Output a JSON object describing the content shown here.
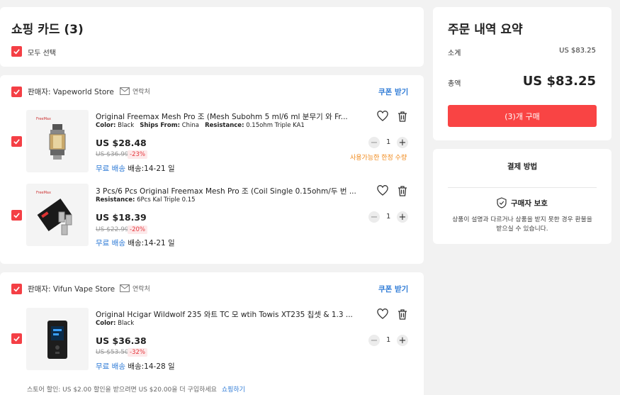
{
  "cart": {
    "title": "쇼핑 카드 (3)",
    "select_all_label": "모두 선택"
  },
  "stores": [
    {
      "seller_label": "판매자: Vapeworld Store",
      "contact_label": "연락처",
      "coupon_label": "쿠폰 받기",
      "items": [
        {
          "name": "Original Freemax Mesh Pro 조 (Mesh Subohm 5 ml/6 ml 분무기 와 Fr...",
          "attrs": [
            {
              "key": "Color:",
              "value": "Black"
            },
            {
              "key": "Ships From:",
              "value": "China"
            },
            {
              "key": "Resistance:",
              "value": "0.15ohm Triple KA1"
            }
          ],
          "price": "US $28.48",
          "original_price": "US $36.99",
          "discount": "-23%",
          "free_shipping": "무료 배송",
          "delivery": "배송:14-21 일",
          "quantity": "1",
          "limit_note": "사용가능한 한정 수량"
        },
        {
          "name": "3 Pcs/6 Pcs Original Freemax Mesh Pro 조 (Coil Single 0.15ohm/두 번 ...",
          "attrs": [
            {
              "key": "Resistance:",
              "value": "6Pcs Kal Triple 0.15"
            }
          ],
          "price": "US $18.39",
          "original_price": "US $22.99",
          "discount": "-20%",
          "free_shipping": "무료 배송",
          "delivery": "배송:14-21 일",
          "quantity": "1"
        }
      ]
    },
    {
      "seller_label": "판매자: Vifun Vape Store",
      "contact_label": "연락처",
      "coupon_label": "쿠폰 받기",
      "items": [
        {
          "name": "Original Hcigar Wildwolf 235 와트 TC 모 wtih Towis XT235 칩셋 & 1.3 ...",
          "attrs": [
            {
              "key": "Color:",
              "value": "Black"
            }
          ],
          "price": "US $36.38",
          "original_price": "US $53.50",
          "discount": "-32%",
          "free_shipping": "무료 배송",
          "delivery": "배송:14-28 일",
          "quantity": "1"
        }
      ],
      "store_discount_note": "스토어 할인: US $2.00 할인을 받으려면 US $20.00을 더 구입하세요",
      "shop_link": "쇼핑하기"
    }
  ],
  "summary": {
    "title": "주문 내역 요약",
    "subtotal_label": "소계",
    "subtotal_value": "US $83.25",
    "total_label": "총액",
    "total_value": "US $83.25",
    "buy_button": "(3)개 구매"
  },
  "payment": {
    "title": "결제 방법",
    "protection_title": "구매자 보호",
    "protection_text_line1": "상품이 설명과 다르거나 상품을 받지 못한 경우 환불을",
    "protection_text_line2": "받으실 수 있습니다."
  },
  "colors": {
    "accent": "#f43f45",
    "link": "#2d7ad6",
    "warning": "#f08a1c"
  }
}
